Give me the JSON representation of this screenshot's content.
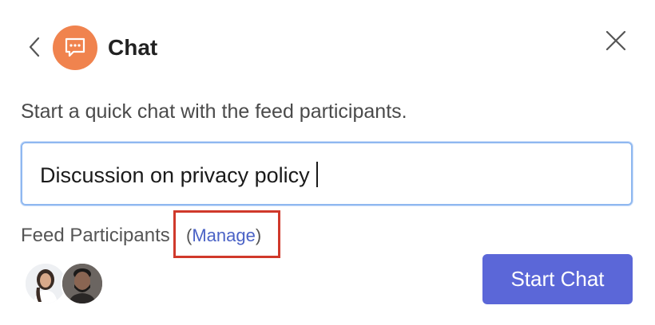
{
  "header": {
    "title": "Chat",
    "back_icon": "chevron-left-icon",
    "badge_icon": "chat-bubble-icon",
    "close_icon": "close-icon",
    "badge_color": "#f0834e"
  },
  "description": "Start a quick chat with the feed participants.",
  "topic_input": {
    "value": "Discussion on privacy policy",
    "focused": true
  },
  "participants": {
    "label": "Feed Participants",
    "open_paren": "(",
    "manage_label": "Manage",
    "close_paren": ")",
    "avatars": [
      {
        "name": "avatar-woman"
      },
      {
        "name": "avatar-man"
      }
    ]
  },
  "start_button": {
    "label": "Start Chat",
    "color": "#5b67d8"
  },
  "highlight_color": "#d0392b"
}
